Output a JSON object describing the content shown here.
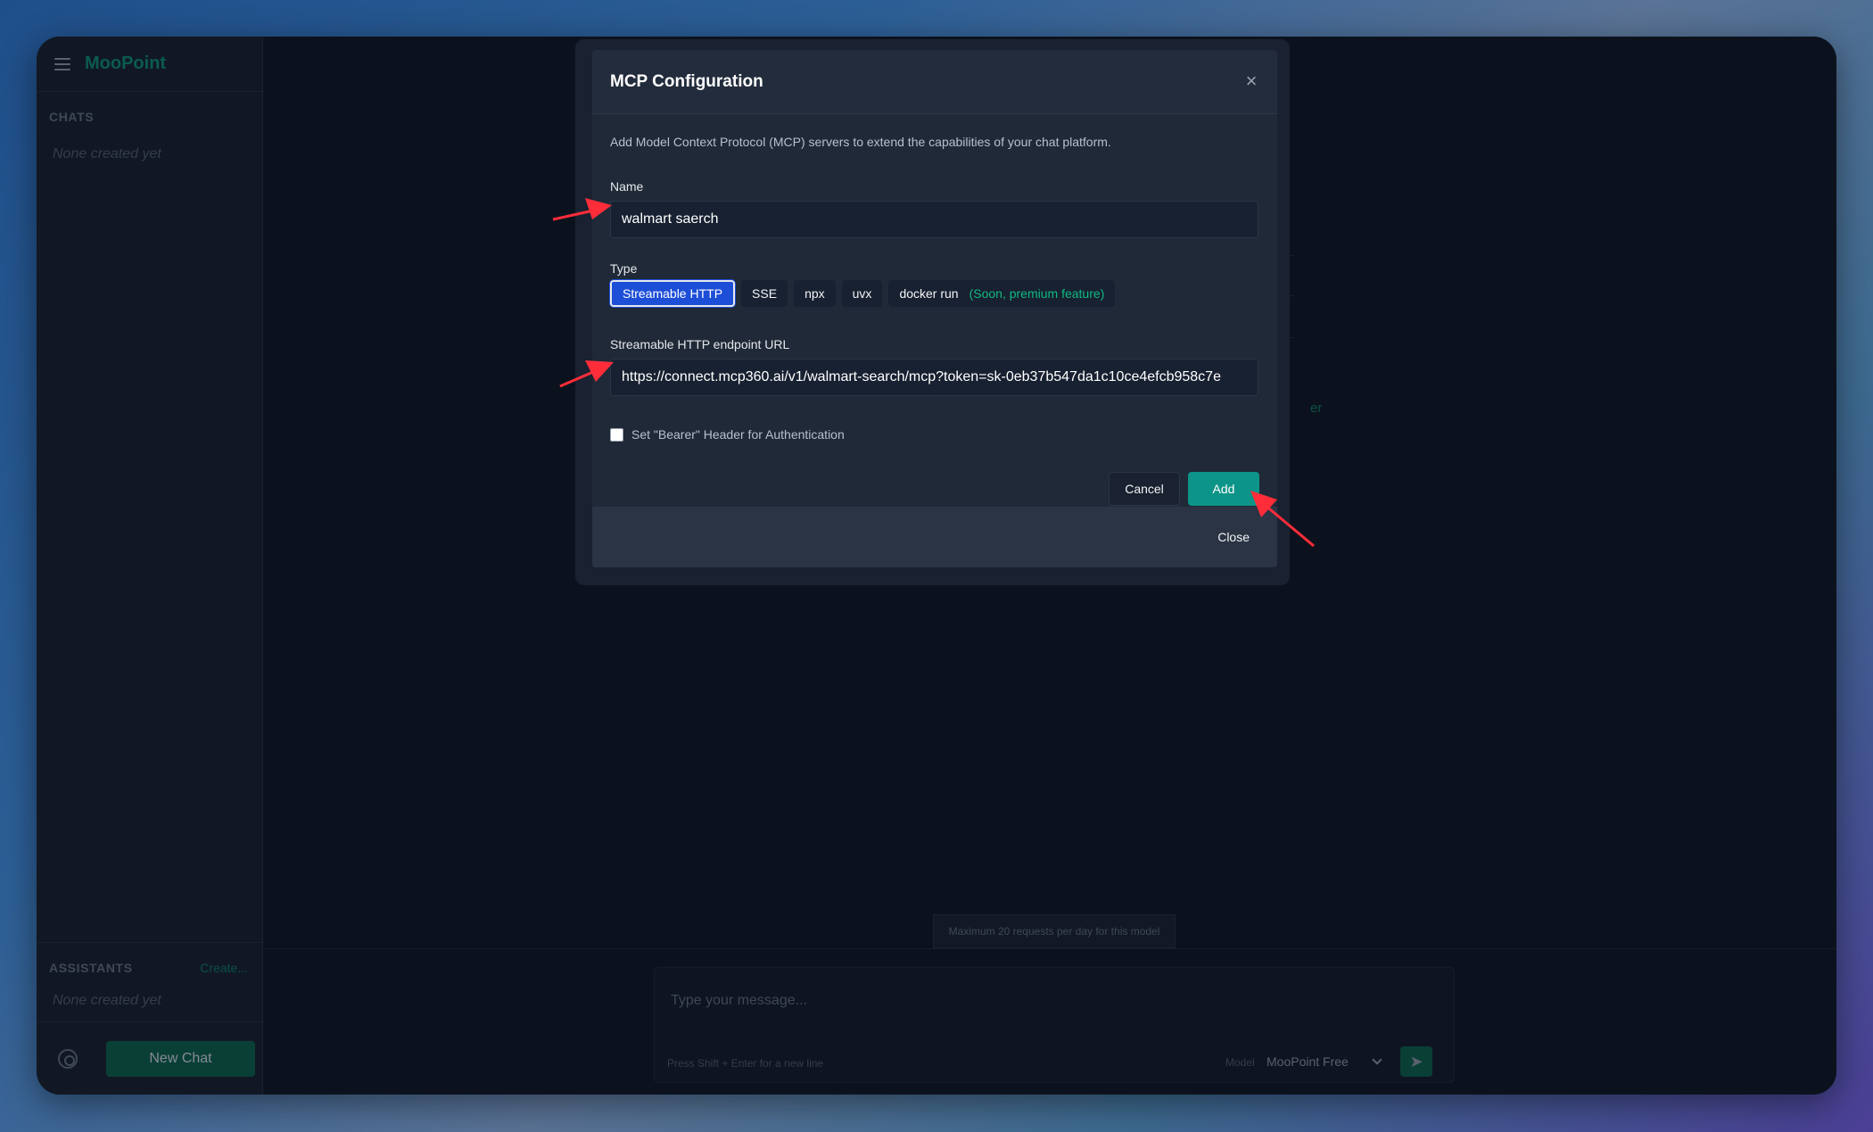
{
  "app": {
    "brand": "MooPoint",
    "sidebar": {
      "chats_title": "CHATS",
      "chats_empty": "None created yet",
      "assistants_title": "ASSISTANTS",
      "assistants_create": "Create...",
      "assistants_empty": "None created yet",
      "new_chat_label": "New Chat"
    },
    "main": {
      "notice": "Maximum 20 requests per day for this model",
      "composer_placeholder": "Type your message...",
      "composer_hint": "Press Shift + Enter for a new line",
      "model_label": "Model",
      "model_value": "MooPoint Free",
      "background_partial_text": "er"
    }
  },
  "modal": {
    "title": "MCP Configuration",
    "description": "Add Model Context Protocol (MCP) servers to extend the capabilities of your chat platform.",
    "name_label": "Name",
    "name_value": "walmart saerch",
    "type_label": "Type",
    "types": [
      {
        "label": "Streamable HTTP",
        "active": true
      },
      {
        "label": "SSE",
        "active": false
      },
      {
        "label": "npx",
        "active": false
      },
      {
        "label": "uvx",
        "active": false
      },
      {
        "label": "docker run",
        "active": false,
        "note": "(Soon, premium feature)"
      }
    ],
    "url_label": "Streamable HTTP endpoint URL",
    "url_value": "https://connect.mcp360.ai/v1/walmart-search/mcp?token=sk-0eb37b547da1c10ce4efcb958c7e",
    "bearer_label": "Set \"Bearer\" Header for Authentication",
    "bearer_checked": false,
    "cancel_label": "Cancel",
    "add_label": "Add",
    "close_label": "Close"
  },
  "colors": {
    "accent": "#0d9488",
    "active_type": "#1d4ed8",
    "annotation_arrow": "#ff2d3a"
  }
}
